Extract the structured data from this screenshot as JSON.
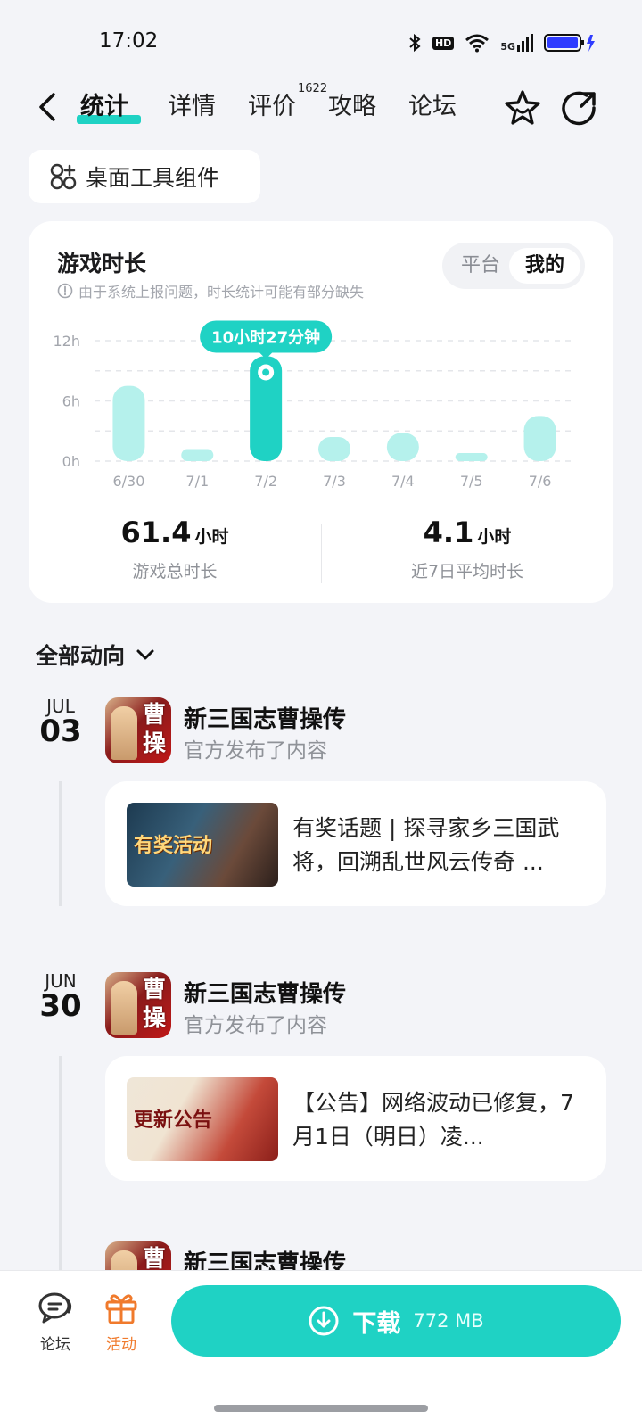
{
  "status_bar": {
    "time": "17:02",
    "hd": "HD",
    "network": "5G",
    "icons": [
      "bluetooth-icon",
      "hd-icon",
      "wifi-icon",
      "signal-5g-icon",
      "battery-charging-icon"
    ]
  },
  "nav": {
    "tabs": [
      {
        "label": "统计",
        "active": true
      },
      {
        "label": "详情",
        "active": false
      },
      {
        "label": "评价",
        "active": false
      },
      {
        "label": "攻略",
        "active": false
      },
      {
        "label": "论坛",
        "active": false
      }
    ],
    "review_count": "1622",
    "icons": [
      "back-arrow-icon",
      "star-icon",
      "share-icon"
    ]
  },
  "widget_chip": {
    "label": "桌面工具组件",
    "icon": "widget-grid-icon"
  },
  "stats_card": {
    "title": "游戏时长",
    "note": "由于系统上报问题，时长统计可能有部分缺失",
    "segment": {
      "platform": "平台",
      "mine": "我的",
      "selected": "我的"
    },
    "accent_color": "#1fd2c4",
    "bar_color": "#b5f1ec",
    "summary": [
      {
        "value": "61.4",
        "unit": "小时",
        "label": "游戏总时长"
      },
      {
        "value": "4.1",
        "unit": "小时",
        "label": "近7日平均时长"
      }
    ]
  },
  "chart_data": {
    "type": "bar",
    "categories": [
      "6/30",
      "7/1",
      "7/2",
      "7/3",
      "7/4",
      "7/5",
      "7/6"
    ],
    "values": [
      7.5,
      1.2,
      10.45,
      2.4,
      2.8,
      0.8,
      4.5
    ],
    "highlight_index": 2,
    "highlight_label": "10小时27分钟",
    "yticks": [
      "0h",
      "6h",
      "12h"
    ],
    "ytick_values": [
      0,
      6,
      12
    ],
    "ylim": [
      0,
      12
    ],
    "grid": true
  },
  "feed": {
    "header": "全部动向",
    "entries": [
      {
        "month": "JUL",
        "day": "03",
        "game_name": "新三国志曹操传",
        "subtitle": "官方发布了内容",
        "icon_chars": "曹操",
        "post_thumb_caption": "有奖活动",
        "post_text": "有奖话题 | 探寻家乡三国武将，回溯乱世风云传奇 ..."
      },
      {
        "month": "JUN",
        "day": "30",
        "game_name": "新三国志曹操传",
        "subtitle": "官方发布了内容",
        "icon_chars": "曹操",
        "post_thumb_caption": "更新公告",
        "post_text": "【公告】网络波动已修复，7月1日（明日）凌..."
      },
      {
        "game_name": "新三国志曹操传",
        "icon_chars": "曹操"
      }
    ]
  },
  "bottom_bar": {
    "forum": {
      "label": "论坛",
      "icon": "chat-bubble-icon",
      "color": "#333333"
    },
    "activity": {
      "label": "活动",
      "icon": "gift-icon",
      "color": "#f07a2c"
    },
    "download": {
      "label": "下载",
      "size": "772 MB",
      "icon": "download-icon"
    }
  }
}
